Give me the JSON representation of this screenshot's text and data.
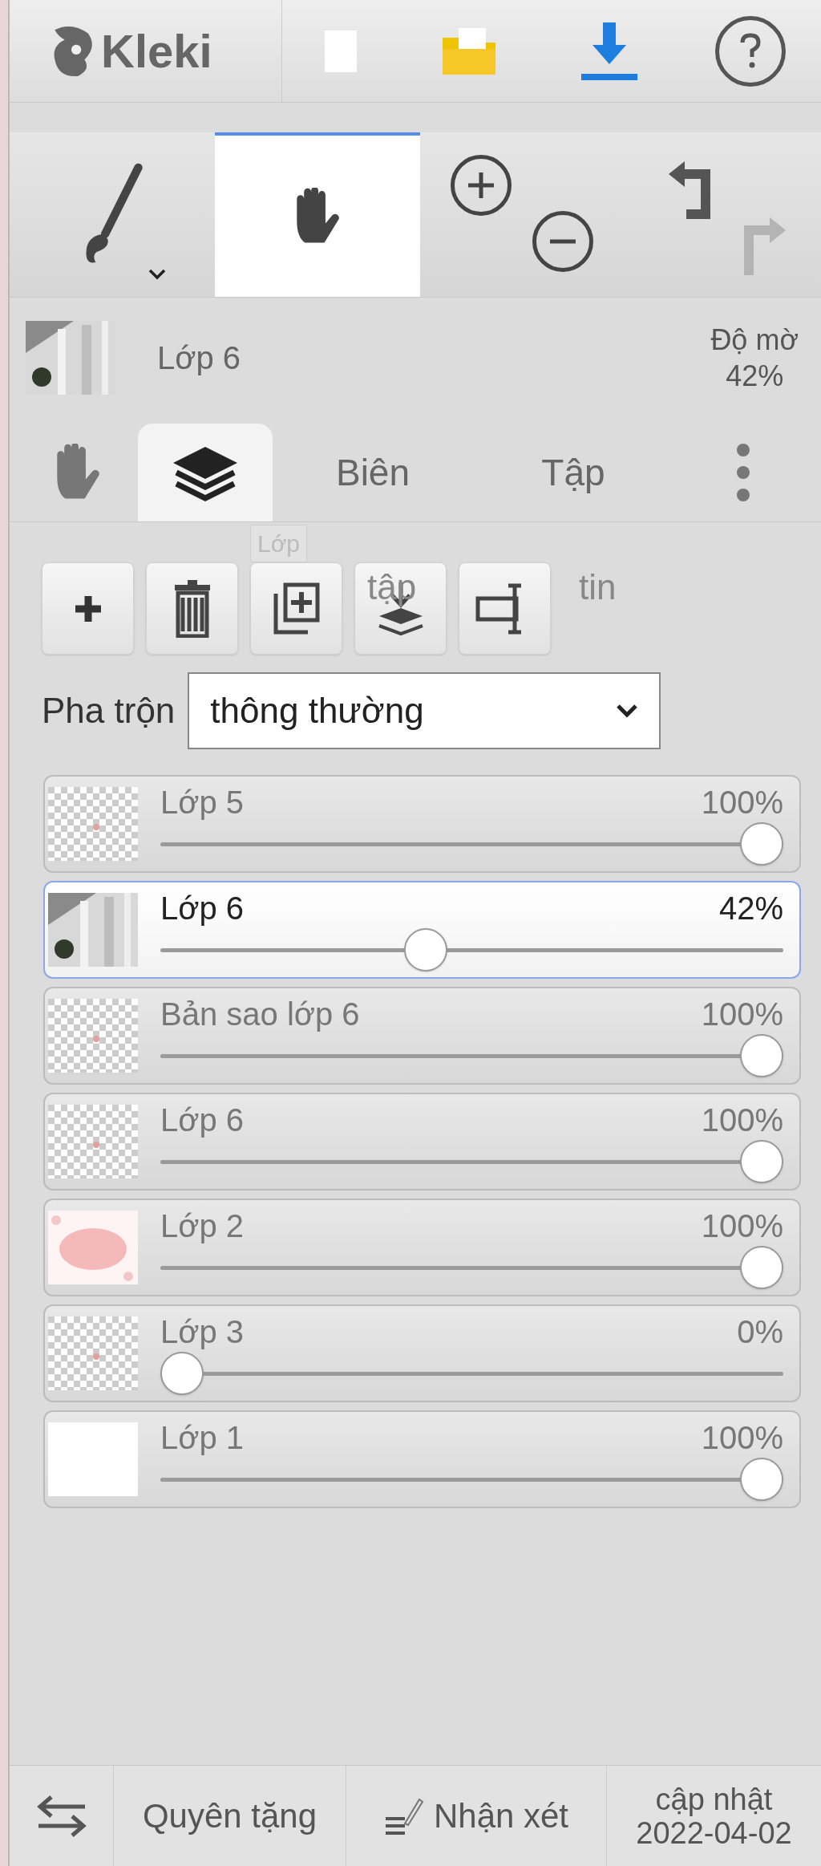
{
  "app": {
    "logo": "Kleki"
  },
  "tools": [
    {
      "kind": "brush",
      "selected": false
    },
    {
      "kind": "hand",
      "selected": true
    }
  ],
  "active_layer": {
    "name": "Lớp 6",
    "opacity_label": "Độ mờ",
    "opacity": "42%"
  },
  "tabs": [
    {
      "kind": "hand",
      "selected": false
    },
    {
      "kind": "layers",
      "selected": true
    },
    {
      "kind": "text",
      "label": "Biên",
      "selected": false
    },
    {
      "kind": "text",
      "label": "Tập",
      "selected": false
    },
    {
      "kind": "more",
      "selected": false
    }
  ],
  "layer_tools": {
    "tooltip": "Lớp",
    "overflow_texts": [
      "tập",
      "tin"
    ]
  },
  "blend": {
    "label": "Pha trộn",
    "value": "thông thường"
  },
  "layers": [
    {
      "name": "Lớp 5",
      "opacity": "100%",
      "level": 1,
      "selected": false
    },
    {
      "name": "Lớp 6",
      "opacity": "42%",
      "level": 0.42,
      "selected": true
    },
    {
      "name": "Bản sao lớp 6",
      "opacity": "100%",
      "level": 1,
      "selected": false
    },
    {
      "name": "Lớp 6",
      "opacity": "100%",
      "level": 1,
      "selected": false
    },
    {
      "name": "Lớp 2",
      "opacity": "100%",
      "level": 1,
      "selected": false
    },
    {
      "name": "Lớp 3",
      "opacity": "0%",
      "level": 0,
      "selected": false
    },
    {
      "name": "Lớp 1",
      "opacity": "100%",
      "level": 1,
      "selected": false
    }
  ],
  "footer": {
    "donate": "Quyên tặng",
    "feedback": "Nhận xét",
    "update_line1": "cập nhật",
    "update_line2": "2022-04-02"
  }
}
